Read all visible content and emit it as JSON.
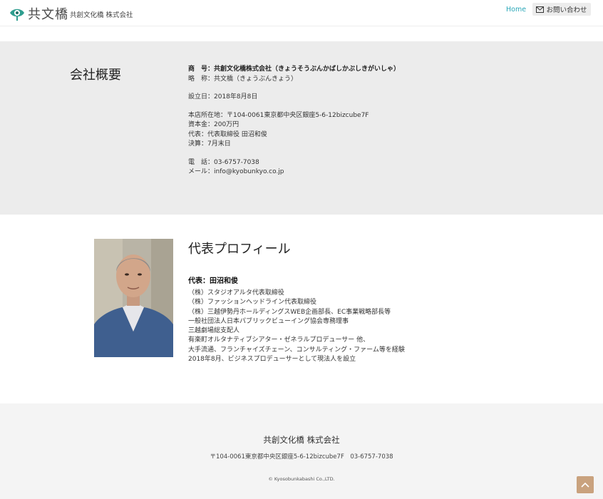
{
  "header": {
    "site_name": "共文橋",
    "site_sub": "共創文化橋 株式会社",
    "nav_home": "Home",
    "contact_label": "お問い合わせ",
    "icons": {
      "logo": "eye-hand-logo-icon",
      "mail": "envelope-icon"
    },
    "colors": {
      "accent": "#2aa7b8"
    }
  },
  "company": {
    "title": "会社概要",
    "lines": [
      "商　号：共創文化橋株式会社（きょうそうぶんかばしかぶしきがいしゃ）",
      "略　称：共文橋（きょうぶんきょう）",
      "設立日：2018年8月8日",
      "本店所在地：〒104-0061東京都中央区銀座5-6-12bizcube7F",
      "資本金：200万円",
      "代表：代表取締役 田沼和俊",
      "決算：7月末日",
      "電　話：03-6757-7038",
      "メール：info@kyobunkyo.co.jp"
    ]
  },
  "profile": {
    "title": "代表プロフィール",
    "rep_name": "代表：田沼和俊",
    "bio": [
      "（株）スタジオアルタ代表取締役",
      "（株）ファッションヘッドライン代表取締役",
      "（株）三越伊勢丹ホールディングスWEB企画部長、EC事業戦略部長等",
      "一般社団法人日本パブリックビューイング協会専務理事",
      "三越劇場総支配人",
      "有楽町オルタナティブシアター・ゼネラルプロデューサー 他、",
      "大手流通、フランチャイズチェーン、コンサルティング・ファーム等を経験",
      "2018年8月、ビジネスプロデューサーとして現法人を設立"
    ]
  },
  "footer": {
    "company_name": "共創文化橋 株式会社",
    "address": "〒104-0061東京都中央区銀座5-6-12bizcube7F　03-6757-7038",
    "copyright": "© Kyosobunkabashi Co.,LTD.",
    "scroll_top_icon": "chevron-up-icon",
    "scroll_top_color": "#c9a27e"
  }
}
